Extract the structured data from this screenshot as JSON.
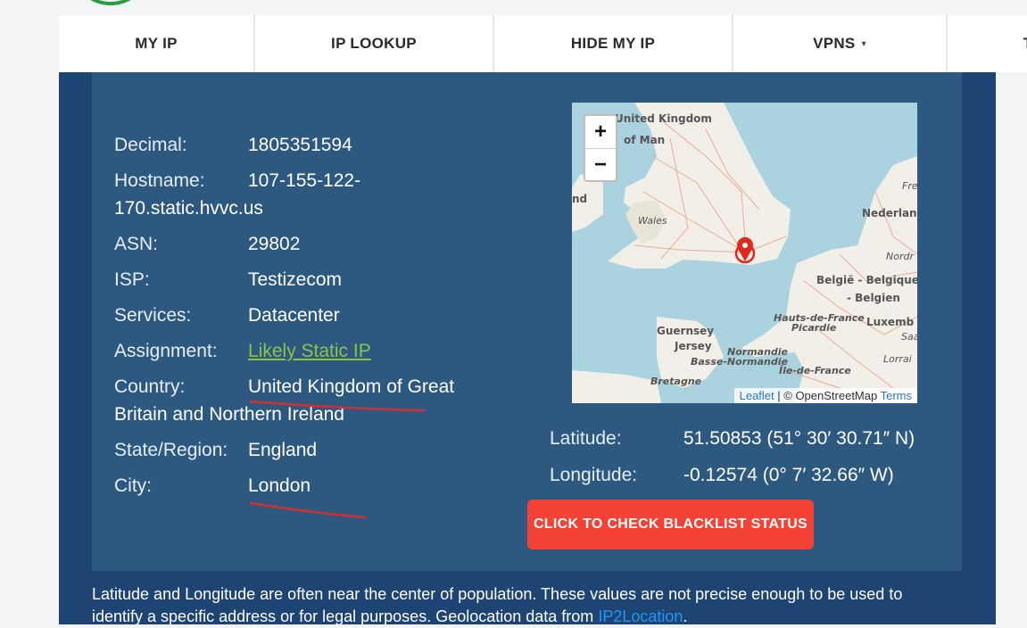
{
  "nav": {
    "items": [
      "MY IP",
      "IP LOOKUP",
      "HIDE MY IP",
      "VPNS",
      "T"
    ],
    "caret": "▾"
  },
  "details": {
    "decimal": {
      "label": "Decimal:",
      "value": "1805351594"
    },
    "hostname": {
      "label": "Hostname:",
      "value": "107-155-122-",
      "value_cont": "170.static.hvvc.us"
    },
    "asn": {
      "label": "ASN:",
      "value": "29802"
    },
    "isp": {
      "label": "ISP:",
      "value": "Testizecom"
    },
    "services": {
      "label": "Services:",
      "value": "Datacenter"
    },
    "assignment": {
      "label": "Assignment:",
      "value": "Likely Static IP"
    },
    "country": {
      "label": "Country:",
      "value": "United Kingdom of Great",
      "value_cont": "Britain and Northern Ireland"
    },
    "state": {
      "label": "State/Region:",
      "value": "England"
    },
    "city": {
      "label": "City:",
      "value": "London"
    }
  },
  "map": {
    "zoom_in": "+",
    "zoom_out": "−",
    "labels": [
      "United Kingdom",
      "of Man",
      "nd",
      "Wales",
      "Fre",
      "Nederlan",
      "Nordr",
      "België - Belgique",
      "- Belgien",
      "Luxemb",
      "Hauts-de-France",
      "Picardie",
      "Guernsey",
      "Jersey",
      "Normandie",
      "Basse-Normandie",
      "Île-de-France",
      "Bretagne",
      "Lorrai",
      "Saa"
    ],
    "attribution": {
      "leaflet": "Leaflet",
      "separator": " | © OpenStreetMap ",
      "terms": "Terms"
    }
  },
  "coords": {
    "latitude": {
      "label": "Latitude:",
      "value": "51.50853  (51° 30′ 30.71″ N)"
    },
    "longitude": {
      "label": "Longitude:",
      "value": "-0.12574  (0° 7′ 32.66″ W)"
    }
  },
  "blacklist_button": "CLICK TO CHECK BLACKLIST STATUS",
  "note": {
    "text": "Latitude and Longitude are often near the center of population. These values are not precise enough to be used to identify a specific address or for legal purposes. Geolocation data from ",
    "source": "IP2Location",
    "end": "."
  },
  "colors": {
    "nav_bg": "#ffffff",
    "page_bg": "#1d4473",
    "panel_bg": "#2d5980",
    "button": "#f44336",
    "link": "#8bc34a",
    "annotation": "#d32f2f"
  }
}
